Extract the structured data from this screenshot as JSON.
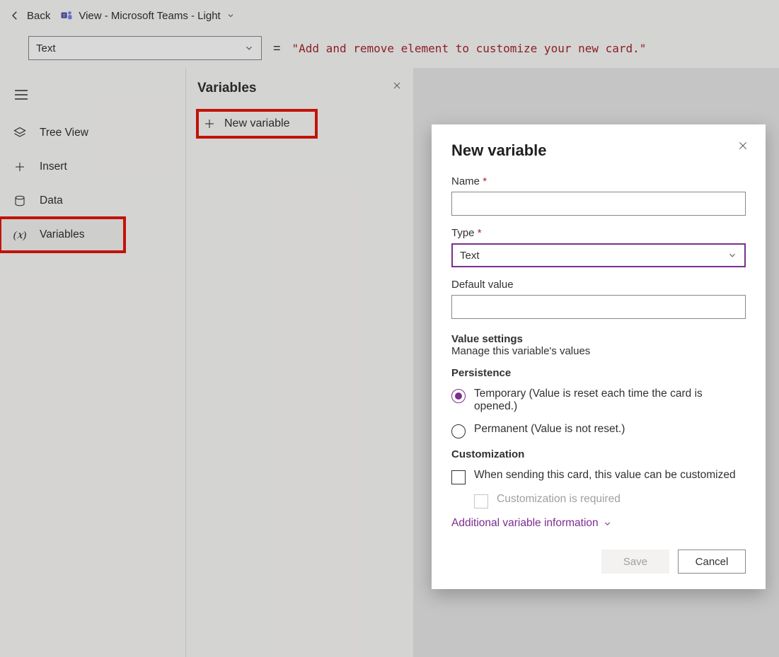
{
  "topbar": {
    "back_label": "Back",
    "view_label": "View - Microsoft Teams - Light"
  },
  "formula": {
    "property": "Text",
    "value": "\"Add and remove element to customize your new card.\""
  },
  "nav": {
    "items": [
      {
        "label": "Tree View"
      },
      {
        "label": "Insert"
      },
      {
        "label": "Data"
      },
      {
        "label": "Variables"
      }
    ]
  },
  "variables_panel": {
    "title": "Variables",
    "new_button": "New variable"
  },
  "dialog": {
    "title": "New variable",
    "name_label": "Name",
    "type_label": "Type",
    "type_value": "Text",
    "default_label": "Default value",
    "value_settings_head": "Value settings",
    "value_settings_sub": "Manage this variable's values",
    "persistence_head": "Persistence",
    "radio_temp": "Temporary (Value is reset each time the card is opened.)",
    "radio_perm": "Permanent (Value is not reset.)",
    "customization_head": "Customization",
    "check_customize": "When sending this card, this value can be customized",
    "check_required": "Customization is required",
    "link_more": "Additional variable information",
    "save": "Save",
    "cancel": "Cancel"
  }
}
